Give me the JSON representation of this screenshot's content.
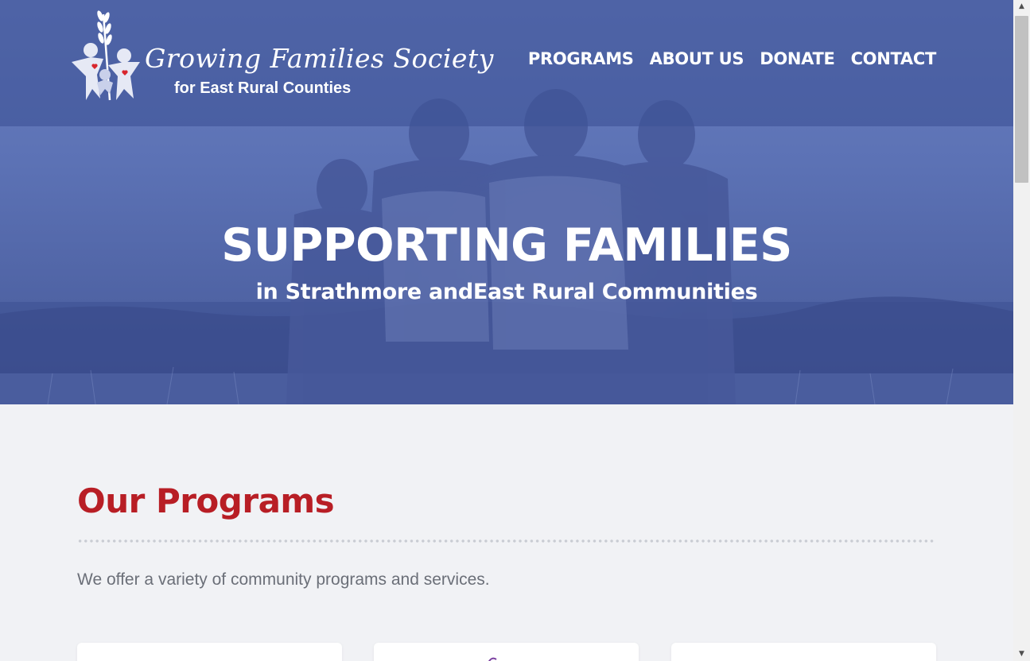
{
  "logo": {
    "title": "Growing Families Society",
    "subtitle": "for East Rural Counties"
  },
  "nav": {
    "items": [
      "PROGRAMS",
      "ABOUT US",
      "DONATE",
      "CONTACT"
    ]
  },
  "hero": {
    "title": "SUPPORTING FAMILIES",
    "subtitle": "in Strathmore andEast Rural Communities"
  },
  "programs": {
    "title": "Our Programs",
    "description": "We offer a variety of community programs and services."
  },
  "colors": {
    "brand_blue": "#4f63a4",
    "accent_red": "#b81e25",
    "card_mark": "#7b3fa0"
  },
  "icons": {
    "logo": "family-wheat-logo",
    "scroll_up": "arrow-up-icon",
    "scroll_down": "arrow-down-icon"
  }
}
